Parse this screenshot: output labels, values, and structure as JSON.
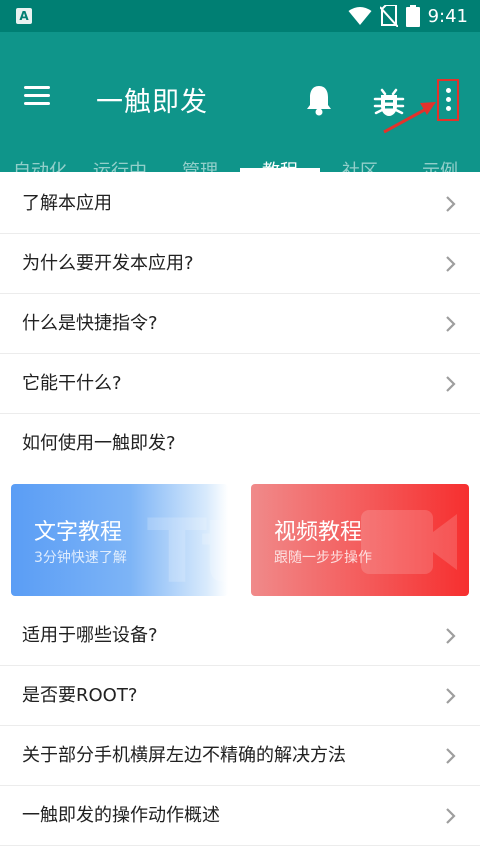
{
  "status_bar": {
    "app_icon_letter": "A",
    "time": "9:41",
    "icons": [
      "wifi-icon",
      "no-sim-icon",
      "battery-icon"
    ]
  },
  "app_bar": {
    "title": "一触即发",
    "icons": [
      "menu-icon",
      "bell-icon",
      "bug-icon",
      "more-vert-icon"
    ],
    "colors": {
      "app_bar": "#0f958a",
      "status_bar": "#007f73",
      "annotation": "#e3322b"
    }
  },
  "tabs": [
    {
      "label": "自动化"
    },
    {
      "label": "运行中"
    },
    {
      "label": "管理"
    },
    {
      "label": "教程"
    },
    {
      "label": "社区"
    },
    {
      "label": "示例"
    }
  ],
  "active_tab": "教程",
  "list_top": [
    {
      "label": "了解本应用"
    },
    {
      "label": "为什么要开发本应用?"
    },
    {
      "label": "什么是快捷指令?"
    },
    {
      "label": "它能干什么?"
    },
    {
      "label": "如何使用一触即发?"
    }
  ],
  "cards": {
    "text_tutorial": {
      "title": "文字教程",
      "subtitle": "3分钟快速了解",
      "watermark": "Tt"
    },
    "video_tutorial": {
      "title": "视频教程",
      "subtitle": "跟随一步步操作"
    }
  },
  "list_bottom": [
    {
      "label": "适用于哪些设备?"
    },
    {
      "label": "是否要ROOT?"
    },
    {
      "label": "关于部分手机横屏左边不精确的解决方法"
    },
    {
      "label": "一触即发的操作动作概述"
    }
  ]
}
